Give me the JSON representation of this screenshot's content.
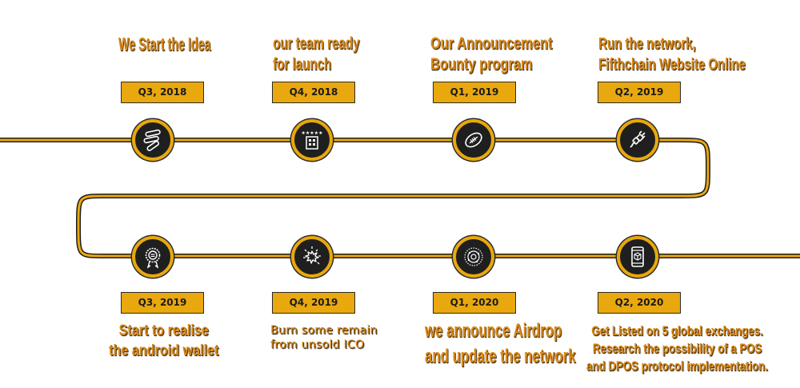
{
  "colors": {
    "accent": "#e9a80d",
    "line_dark": "#1c1c1c",
    "node_fill": "#1f1f1f",
    "caption": "#d8891a"
  },
  "milestones": [
    {
      "date": "Q3, 2018",
      "icon": "pills-icon",
      "lines": [
        "We Start  the Idea"
      ]
    },
    {
      "date": "Q4, 2018",
      "icon": "building-stars-icon",
      "lines": [
        "our team ready",
        "for launch"
      ]
    },
    {
      "date": "Q1, 2019",
      "icon": "rugby-ball-icon",
      "lines": [
        "Our Announcement",
        "Bounty program"
      ]
    },
    {
      "date": "Q2, 2019",
      "icon": "plug-icon",
      "lines": [
        "Run the network,",
        "Fifthchain Website Online"
      ]
    },
    {
      "date": "Q3, 2019",
      "icon": "award-badge-icon",
      "lines": [
        "Start to realise",
        "the android wallet"
      ]
    },
    {
      "date": "Q4, 2019",
      "icon": "burst-icon",
      "lines": [
        "Burn some remain",
        "from unsold ICO"
      ]
    },
    {
      "date": "Q1, 2020",
      "icon": "network-sphere-icon",
      "lines": [
        "we announce Airdrop",
        "and update the network"
      ]
    },
    {
      "date": "Q2, 2020",
      "icon": "mobile-cube-icon",
      "lines": [
        "Get Listed on 5 global exchanges.",
        "Research the possibility of a POS",
        "and DPOS protocol implementation."
      ]
    }
  ]
}
